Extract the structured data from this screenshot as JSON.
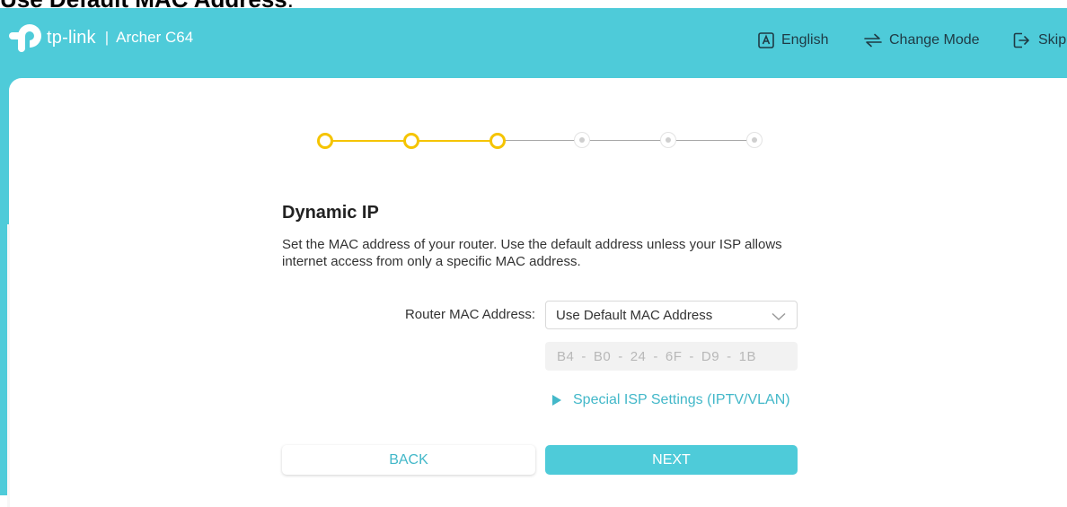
{
  "caption": {
    "prefix": "Use Default MAC Address",
    "suffix": "."
  },
  "header": {
    "brand": "tp-link",
    "separator": "|",
    "model": "Archer C64",
    "language": "English",
    "change_mode": "Change Mode",
    "skip": "Skip"
  },
  "steps": {
    "total": 6,
    "completed": 3,
    "active_color": "#f5c400"
  },
  "section": {
    "title": "Dynamic IP",
    "description": "Set the MAC address of your router. Use the default address unless your ISP allows internet access from only a specific MAC address."
  },
  "mac": {
    "label": "Router MAC Address:",
    "selected": "Use Default MAC Address",
    "b1": "B4",
    "b2": "B0",
    "b3": "24",
    "b4": "6F",
    "b5": "D9",
    "b6": "1B",
    "dash": "-"
  },
  "special_isp": "Special ISP Settings (IPTV/VLAN)",
  "buttons": {
    "back": "BACK",
    "next": "NEXT"
  },
  "colors": {
    "accent": "#4ecbd9",
    "link": "#43b8c9",
    "step_active": "#f5c400"
  }
}
